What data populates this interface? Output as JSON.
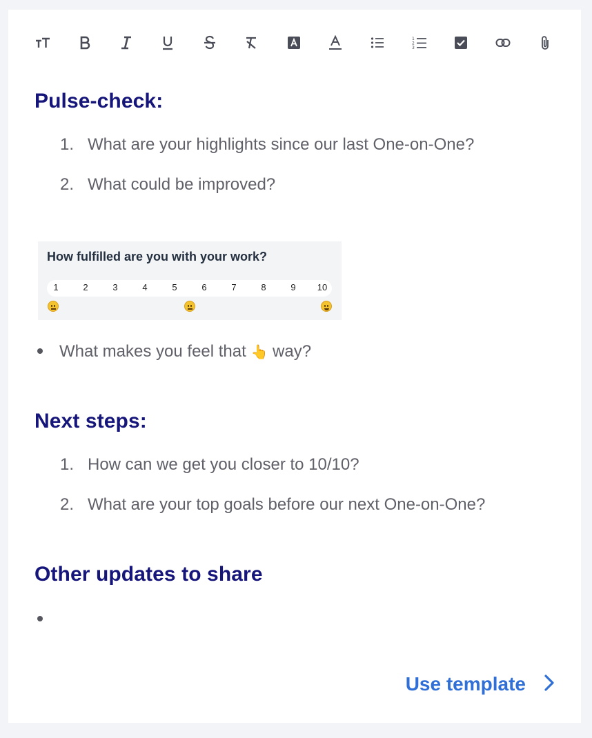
{
  "toolbar": {
    "icons": [
      "text-size-icon",
      "bold-icon",
      "italic-icon",
      "underline-icon",
      "strikethrough-icon",
      "clear-format-icon",
      "highlight-icon",
      "text-color-icon",
      "bullet-list-icon",
      "numbered-list-icon",
      "checkbox-icon",
      "link-icon",
      "attachment-icon"
    ]
  },
  "sections": {
    "pulse": {
      "heading": "Pulse-check:",
      "items": [
        {
          "num": "1.",
          "text": "What are your highlights since our last One-on-One?"
        },
        {
          "num": "2.",
          "text": "What could be improved?"
        }
      ]
    },
    "scale": {
      "title": "How fulfilled are you with your work?",
      "numbers": [
        "1",
        "2",
        "3",
        "4",
        "5",
        "6",
        "7",
        "8",
        "9",
        "10"
      ]
    },
    "feel": {
      "before": "What makes you feel that ",
      "emoji": "👆",
      "after": " way?"
    },
    "next": {
      "heading": "Next steps:",
      "items": [
        {
          "num": "1.",
          "text": "How can we get you closer to 10/10?"
        },
        {
          "num": "2.",
          "text": "What are your top goals before our next One-on-One?"
        }
      ]
    },
    "other": {
      "heading": "Other updates to share"
    }
  },
  "cta": {
    "label": "Use template",
    "icon": "chevron-right-icon"
  },
  "colors": {
    "heading": "#15157a",
    "body_text": "#5f6068",
    "accent": "#2f6fd6"
  }
}
